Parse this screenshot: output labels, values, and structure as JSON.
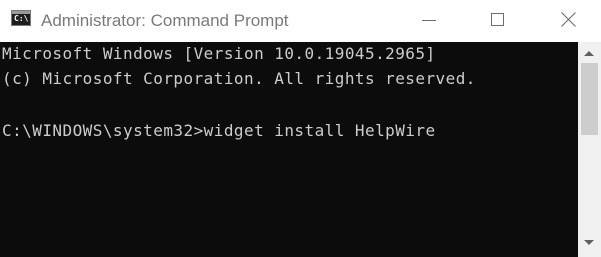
{
  "window": {
    "title": "Administrator: Command Prompt",
    "app_icon": "command-prompt-icon",
    "app_icon_glyph": "C:\\",
    "controls": {
      "minimize_icon": "minimize-icon",
      "maximize_icon": "maximize-icon",
      "close_icon": "close-icon"
    }
  },
  "console": {
    "lines": [
      "Microsoft Windows [Version 10.0.19045.2965]",
      "(c) Microsoft Corporation. All rights reserved.",
      "C:\\WINDOWS\\system32>widget install HelpWire"
    ],
    "background_color": "#0c0c0c",
    "text_color": "#cccccc"
  },
  "scrollbar": {
    "up_icon": "scroll-up-arrow-icon",
    "down_icon": "scroll-down-arrow-icon"
  }
}
